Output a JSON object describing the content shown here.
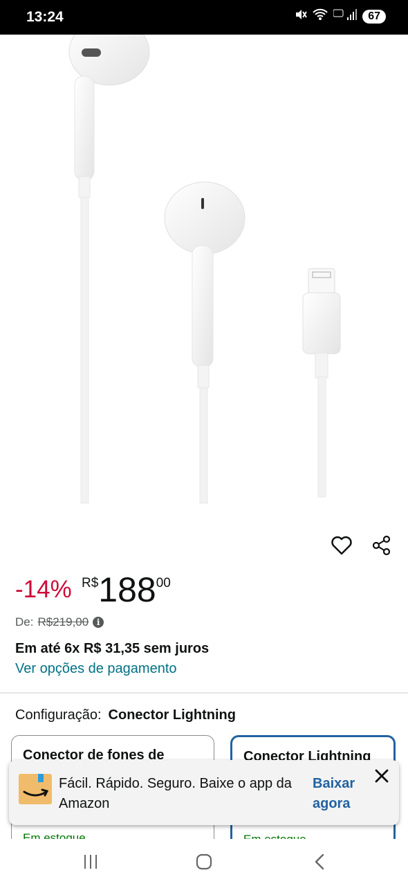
{
  "status_bar": {
    "time": "13:24",
    "battery": "67"
  },
  "product": {
    "discount": "-14%",
    "currency": "R$",
    "price_whole": "188",
    "price_fraction": "00",
    "list_price_label": "De:",
    "list_price": "R$219,00",
    "installments": "Em até 6x R$ 31,35 sem juros",
    "payment_link": "Ver opções de pagamento"
  },
  "configuration": {
    "label": "Configuração:",
    "selected": "Conector Lightning",
    "options": [
      {
        "title": "Conector de fones de",
        "stock": "Em estoque"
      },
      {
        "title": "Conector Lightning",
        "stock": "Em estoque"
      }
    ]
  },
  "toast": {
    "message": "Fácil. Rápido. Seguro. Baixe o app da Amazon",
    "cta": "Baixar agora"
  },
  "icons": {
    "wishlist": "heart-icon",
    "share": "share-icon",
    "close": "close-icon",
    "logo": "amazon-logo-icon",
    "nav": [
      "recent-apps-icon",
      "home-icon",
      "back-icon"
    ]
  },
  "colors": {
    "discount": "#cc0c39",
    "link": "#007185",
    "selected_border": "#2162a1",
    "stock": "#007600",
    "logo_box": "#f0bc6b"
  }
}
